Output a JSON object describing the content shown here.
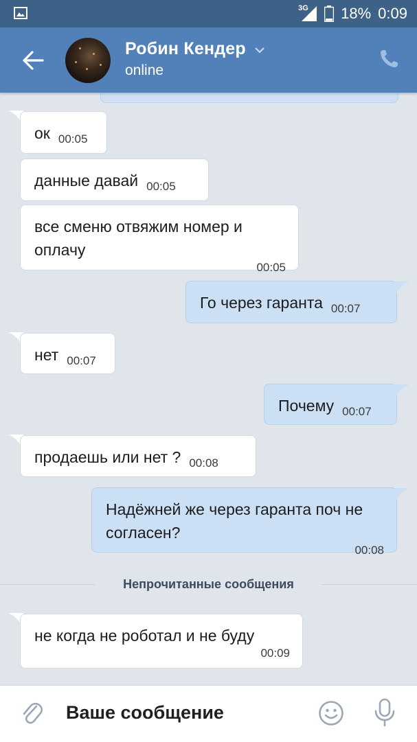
{
  "status_bar": {
    "network": "3G",
    "battery": "18%",
    "time": "0:09",
    "icons": [
      "gallery-icon",
      "signal-icon",
      "battery-icon"
    ]
  },
  "header": {
    "contact_name": "Робин Кендер",
    "presence": "online",
    "icons": [
      "back-arrow-icon",
      "chevron-down-icon",
      "phone-icon"
    ]
  },
  "messages": [
    {
      "dir": "in",
      "text": "ок",
      "time": "00:05"
    },
    {
      "dir": "in",
      "text": "данные давай",
      "time": "00:05"
    },
    {
      "dir": "in",
      "text": "все сменю отвяжим номер и оплачу",
      "time": "00:05"
    },
    {
      "dir": "out",
      "text": "Го через гаранта",
      "time": "00:07"
    },
    {
      "dir": "in",
      "text": "нет",
      "time": "00:07"
    },
    {
      "dir": "out",
      "text": "Почему",
      "time": "00:07"
    },
    {
      "dir": "in",
      "text": "продаешь или нет ?",
      "time": "00:08"
    },
    {
      "dir": "out",
      "text": "Надёжней же через гаранта поч не согласен?",
      "time": "00:08"
    },
    {
      "dir": "in",
      "text": "не когда не роботал и не буду",
      "time": "00:09"
    }
  ],
  "unread_divider": "Непрочитанные сообщения",
  "composer": {
    "placeholder": "Ваше сообщение",
    "icons": [
      "paperclip-icon",
      "emoji-icon",
      "microphone-icon"
    ]
  },
  "colors": {
    "header": "#5181b8",
    "status_bar": "#3e6187",
    "chat_background": "#dfe5eb",
    "incoming_bubble": "#ffffff",
    "outgoing_bubble": "#cce0f5"
  }
}
